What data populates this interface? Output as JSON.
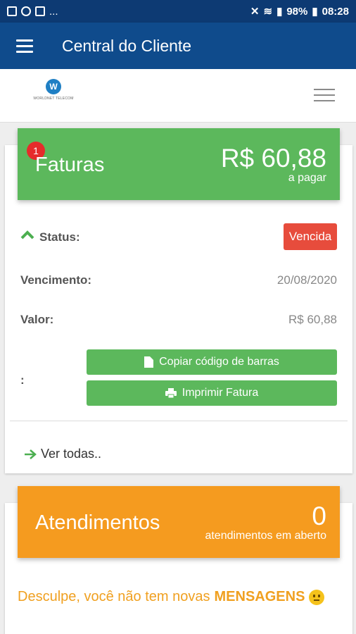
{
  "status_bar": {
    "left_extra": "...",
    "battery": "98%",
    "time": "08:28"
  },
  "app_bar": {
    "title": "Central do Cliente"
  },
  "logo": {
    "text": "WORLDNET TELECOM"
  },
  "faturas": {
    "badge_count": "1",
    "title": "Faturas",
    "amount": "R$ 60,88",
    "amount_sub": "a pagar",
    "status_label": "Status:",
    "status_value": "Vencida",
    "vencimento_label": "Vencimento:",
    "vencimento_value": "20/08/2020",
    "valor_label": "Valor:",
    "valor_value": "R$ 60,88",
    "colon": ":",
    "copy_button": "Copiar código de barras",
    "print_button": "Imprimir Fatura",
    "see_all": "Ver todas.."
  },
  "atendimentos": {
    "title": "Atendimentos",
    "count": "0",
    "count_sub": "atendimentos em aberto",
    "message_prefix": "Desculpe, você não tem novas",
    "message_bold": "MENSAGENS"
  },
  "colors": {
    "status_bar": "#0d3a73",
    "app_bar": "#0f4b8c",
    "green": "#5cb85c",
    "orange": "#f59b1f",
    "red": "#e74c3c"
  }
}
